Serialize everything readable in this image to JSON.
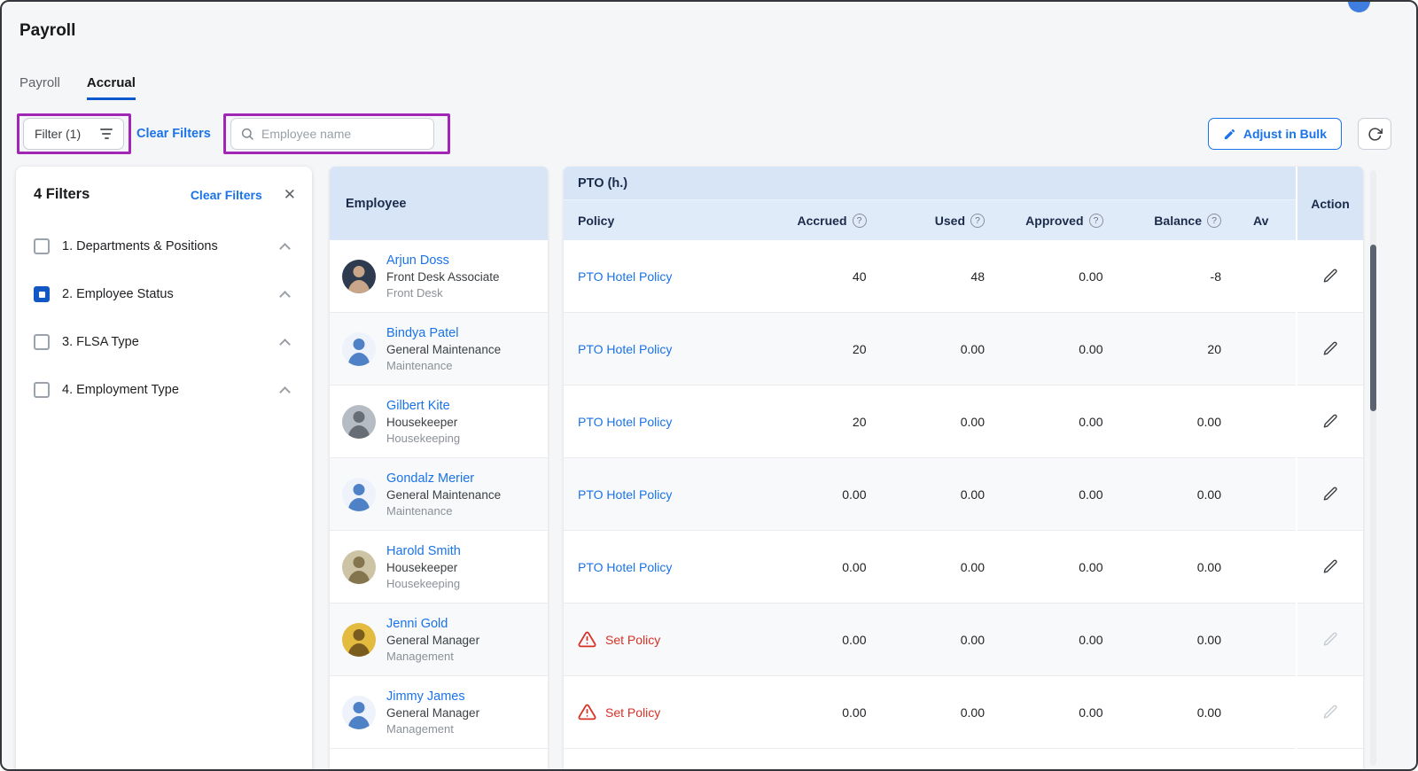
{
  "page": {
    "title": "Payroll"
  },
  "tabs": [
    {
      "label": "Payroll"
    },
    {
      "label": "Accrual"
    }
  ],
  "toolbar": {
    "filter_button_label": "Filter (1)",
    "clear_filters_label": "Clear Filters",
    "search_placeholder": "Employee name",
    "adjust_in_bulk_label": "Adjust in Bulk"
  },
  "filter_panel": {
    "title": "4 Filters",
    "clear_filters_label": "Clear Filters",
    "items": [
      {
        "label": "1. Departments & Positions",
        "checked": false
      },
      {
        "label": "2. Employee Status",
        "checked": true
      },
      {
        "label": "3. FLSA Type",
        "checked": false
      },
      {
        "label": "4. Employment Type",
        "checked": false
      }
    ]
  },
  "table": {
    "employee_header": "Employee",
    "group_header": "PTO (h.)",
    "action_header": "Action",
    "columns": {
      "policy": "Policy",
      "accrued": "Accrued",
      "used": "Used",
      "approved": "Approved",
      "balance": "Balance",
      "available": "Av"
    },
    "rows": [
      {
        "name": "Arjun Doss",
        "position": "Front Desk Associate",
        "department": "Front Desk",
        "policy": "PTO Hotel Policy",
        "policy_set": true,
        "accrued": "40",
        "used": "48",
        "approved": "0.00",
        "balance": "-8",
        "avatar": {
          "type": "photo",
          "bg": "#2e3a4d",
          "fg": "#c9a58a"
        }
      },
      {
        "name": "Bindya Patel",
        "position": "General Maintenance",
        "department": "Maintenance",
        "policy": "PTO Hotel Policy",
        "policy_set": true,
        "accrued": "20",
        "used": "0.00",
        "approved": "0.00",
        "balance": "20",
        "avatar": {
          "type": "generic",
          "bg": "#eef3fb",
          "fg": "#4f81c7"
        }
      },
      {
        "name": "Gilbert Kite",
        "position": "Housekeeper",
        "department": "Housekeeping",
        "policy": "PTO Hotel Policy",
        "policy_set": true,
        "accrued": "20",
        "used": "0.00",
        "approved": "0.00",
        "balance": "0.00",
        "avatar": {
          "type": "photo",
          "bg": "#b6bcc4",
          "fg": "#676d75"
        }
      },
      {
        "name": "Gondalz Merier",
        "position": "General Maintenance",
        "department": "Maintenance",
        "policy": "PTO Hotel Policy",
        "policy_set": true,
        "accrued": "0.00",
        "used": "0.00",
        "approved": "0.00",
        "balance": "0.00",
        "avatar": {
          "type": "generic",
          "bg": "#eef3fb",
          "fg": "#4f81c7"
        }
      },
      {
        "name": "Harold Smith",
        "position": "Housekeeper",
        "department": "Housekeeping",
        "policy": "PTO Hotel Policy",
        "policy_set": true,
        "accrued": "0.00",
        "used": "0.00",
        "approved": "0.00",
        "balance": "0.00",
        "avatar": {
          "type": "photo",
          "bg": "#cdc3a5",
          "fg": "#85754f"
        }
      },
      {
        "name": "Jenni Gold",
        "position": "General Manager",
        "department": "Management",
        "policy": "Set Policy",
        "policy_set": false,
        "accrued": "0.00",
        "used": "0.00",
        "approved": "0.00",
        "balance": "0.00",
        "avatar": {
          "type": "photo",
          "bg": "#e3bb3f",
          "fg": "#7a5c1e"
        }
      },
      {
        "name": "Jimmy James",
        "position": "General Manager",
        "department": "Management",
        "policy": "Set Policy",
        "policy_set": false,
        "accrued": "0.00",
        "used": "0.00",
        "approved": "0.00",
        "balance": "0.00",
        "avatar": {
          "type": "generic",
          "bg": "#eef3fb",
          "fg": "#4f81c7"
        }
      }
    ]
  },
  "icons": {
    "close": "✕"
  },
  "colors": {
    "accent_blue": "#1a73e8",
    "tab_underline": "#0b57d0",
    "header_blue": "#d7e5f7",
    "annotation_purple": "#a226b5",
    "warning_red": "#d93025"
  }
}
